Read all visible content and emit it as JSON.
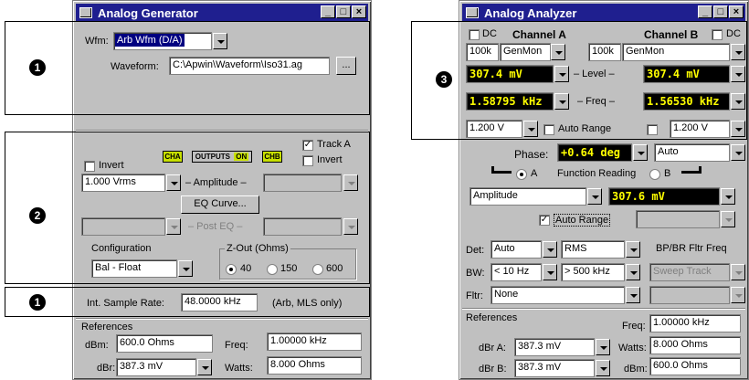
{
  "gen": {
    "title": "Analog Generator",
    "wfm_label": "Wfm:",
    "wfm_value": "Arb Wfm (D/A)",
    "waveform_label": "Waveform:",
    "waveform_path": "C:\\Apwin\\Waveform\\Iso31.ag",
    "browse": "...",
    "invert_label": "Invert",
    "cha": "CHA",
    "outputs": "OUTPUTS",
    "on": "ON",
    "chb": "CHB",
    "tracka_label": "Track A",
    "invert_b_label": "Invert",
    "amplitude_value": "1.000  Vrms",
    "amplitude_label": "– Amplitude –",
    "eq_button": "EQ Curve...",
    "posteq_label": "– Post EQ –",
    "config_label": "Configuration",
    "config_value": "Bal - Float",
    "zout_label": "Z-Out (Ohms)",
    "zout_options": [
      "40",
      "150",
      "600"
    ],
    "sr_label": "Int. Sample Rate:",
    "sr_value": "48.0000 kHz",
    "sr_note": "(Arb, MLS only)",
    "refs_label": "References",
    "dbm_label": "dBm:",
    "dbm_value": "600.0   Ohms",
    "freq_label": "Freq:",
    "freq_value": "1.00000 kHz",
    "dbr_label": "dBr:",
    "dbr_value": "387.3  mV",
    "watts_label": "Watts:",
    "watts_value": "8.000   Ohms"
  },
  "ana": {
    "title": "Analog Analyzer",
    "dc_label": "DC",
    "channel_a": "Channel A",
    "channel_b": "Channel B",
    "dc_b_label": "DC",
    "range_a": "100k",
    "mon_a": "GenMon",
    "range_b": "100k",
    "mon_b": "GenMon",
    "level_a": "307.4   mV",
    "level_label": "– Level –",
    "level_b": "307.4   mV",
    "freq_a": "1.58795 kHz",
    "freq_label": "– Freq –",
    "freq_b": "1.56530 kHz",
    "volt_a": "1.200   V",
    "autorange_label": "Auto Range",
    "volt_b": "1.200   V",
    "phase_label": "Phase:",
    "phase_value": "+0.64   deg",
    "phase_mode": "Auto",
    "fr_a": "A",
    "fr_label": "Function Reading",
    "fr_b": "B",
    "func_value": "Amplitude",
    "func_reading": "307.6   mV",
    "autorange2_label": "Auto Range",
    "det_label": "Det:",
    "det_value": "Auto",
    "det_mode": "RMS",
    "bpbr_label": "BP/BR Fltr Freq",
    "bw_label": "BW:",
    "bw_low": "< 10 Hz",
    "bw_high": "> 500 kHz",
    "sweep_track": "Sweep Track",
    "fltr_label": "Fltr:",
    "fltr_value": "None",
    "refs_label": "References",
    "freq2_label": "Freq:",
    "freq2_value": "1.00000 kHz",
    "dbra_label": "dBr A:",
    "dbra_value": "387.3  mV",
    "watts_label": "Watts:",
    "watts_value": "8.000   Ohms",
    "dbrb_label": "dBr B:",
    "dbrb_value": "387.3  mV",
    "dbm_label": "dBm:",
    "dbm_value": "600.0   Ohms"
  },
  "badges": [
    "1",
    "2",
    "1",
    "3"
  ],
  "colors": {
    "titlebar": "#1f1f8f",
    "window": "#c0c0c0",
    "readout_bg": "#000000",
    "readout_fg": "#ffff00",
    "indicator": "#c8e000"
  }
}
